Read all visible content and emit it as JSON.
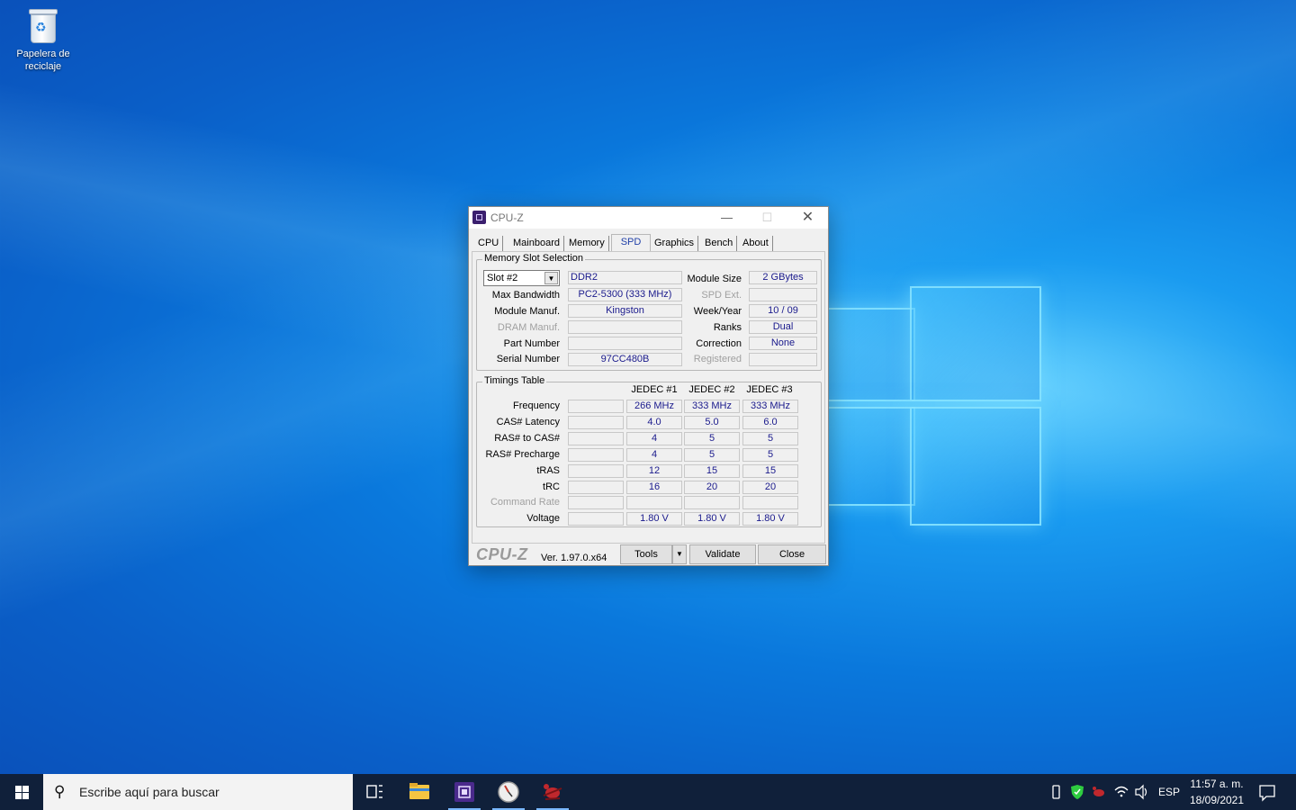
{
  "desktop": {
    "recycle_bin_label_line1": "Papelera de",
    "recycle_bin_label_line2": "reciclaje"
  },
  "window": {
    "title": "CPU-Z",
    "controls": {
      "minimize": "—",
      "maximize": "☐",
      "close": "✕"
    },
    "tabs": [
      "CPU",
      "Mainboard",
      "Memory",
      "SPD",
      "Graphics",
      "Bench",
      "About"
    ],
    "active_tab": "SPD"
  },
  "slot_group": {
    "title": "Memory Slot Selection",
    "slot_value": "Slot #2",
    "memory_type": "DDR2",
    "labels": {
      "max_bandwidth": "Max Bandwidth",
      "module_manuf": "Module Manuf.",
      "dram_manuf": "DRAM Manuf.",
      "part_number": "Part Number",
      "serial_number": "Serial Number",
      "module_size": "Module Size",
      "spd_ext": "SPD Ext.",
      "week_year": "Week/Year",
      "ranks": "Ranks",
      "correction": "Correction",
      "registered": "Registered"
    },
    "values": {
      "max_bandwidth": "PC2-5300 (333 MHz)",
      "module_manuf": "Kingston",
      "dram_manuf": "",
      "part_number": "",
      "serial_number": "97CC480B",
      "module_size": "2 GBytes",
      "spd_ext": "",
      "week_year": "10 / 09",
      "ranks": "Dual",
      "correction": "None",
      "registered": ""
    }
  },
  "timings": {
    "title": "Timings Table",
    "columns": [
      "JEDEC #1",
      "JEDEC #2",
      "JEDEC #3"
    ],
    "rows": [
      {
        "label": "Frequency",
        "values": [
          "266 MHz",
          "333 MHz",
          "333 MHz"
        ]
      },
      {
        "label": "CAS# Latency",
        "values": [
          "4.0",
          "5.0",
          "6.0"
        ]
      },
      {
        "label": "RAS# to CAS#",
        "values": [
          "4",
          "5",
          "5"
        ]
      },
      {
        "label": "RAS# Precharge",
        "values": [
          "4",
          "5",
          "5"
        ]
      },
      {
        "label": "tRAS",
        "values": [
          "12",
          "15",
          "15"
        ]
      },
      {
        "label": "tRC",
        "values": [
          "16",
          "20",
          "20"
        ]
      },
      {
        "label": "Command Rate",
        "values": [
          "",
          "",
          ""
        ]
      },
      {
        "label": "Voltage",
        "values": [
          "1.80 V",
          "1.80 V",
          "1.80 V"
        ]
      }
    ]
  },
  "footer": {
    "logo": "CPU-Z",
    "version": "Ver. 1.97.0.x64",
    "tools": "Tools",
    "validate": "Validate",
    "close": "Close"
  },
  "taskbar": {
    "search_placeholder": "Escribe aquí para buscar",
    "apps": [
      "task-view-icon",
      "file-explorer-icon",
      "cpu-z-icon",
      "clock-app-icon",
      "bug-app-icon"
    ],
    "tray_language": "ESP",
    "time": "11:57 a. m.",
    "date": "18/09/2021"
  },
  "colors": {
    "value_text": "#1a1a8c",
    "active_tab": "#1f3fa8",
    "taskbar": "#10203a"
  }
}
